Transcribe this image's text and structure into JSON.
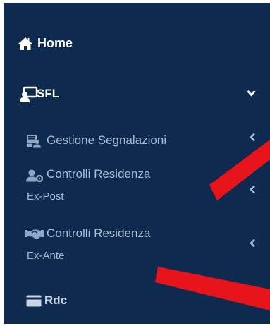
{
  "sidebar": {
    "items": [
      {
        "label": "Home",
        "icon": "home-icon"
      },
      {
        "label": "SFL",
        "icon": "users-screen-icon",
        "chevron": "chevron-down-icon"
      },
      {
        "label": "Gestione Segnalazioni",
        "icon": "notes-group-icon",
        "chevron": "chevron-left-icon"
      },
      {
        "label": "Controlli Residenza",
        "label_line2": "Ex-Post",
        "icon": "user-gear-icon",
        "chevron": "chevron-left-icon"
      },
      {
        "label": "Controlli Residenza",
        "label_line2": "Ex-Ante",
        "icon": "handshake-icon",
        "chevron": "chevron-left-icon"
      },
      {
        "label": "Rdc",
        "icon": "card-icon",
        "chevron": "chevron-left-icon"
      }
    ]
  },
  "colors": {
    "sidebar_bg": "#0f2a4f",
    "active_text": "#ffffff",
    "submenu_text": "#a9bdd6",
    "annotation_red": "#e8141b"
  }
}
